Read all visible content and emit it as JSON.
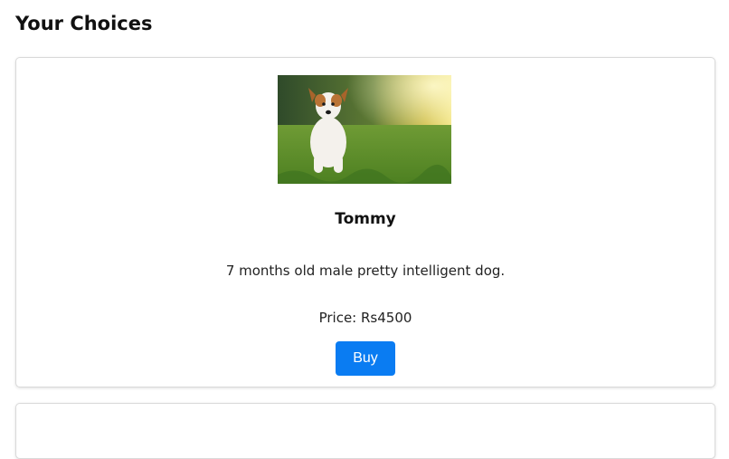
{
  "header": {
    "title": "Your Choices"
  },
  "cards": [
    {
      "image_icon": "dog-photo",
      "name": "Tommy",
      "description": "7 months old male pretty intelligent dog.",
      "price": "Price: Rs4500",
      "buy_label": "Buy"
    }
  ],
  "colors": {
    "button_bg": "#0a7cf2",
    "button_text": "#ffffff",
    "card_border": "#d9d9d9"
  }
}
